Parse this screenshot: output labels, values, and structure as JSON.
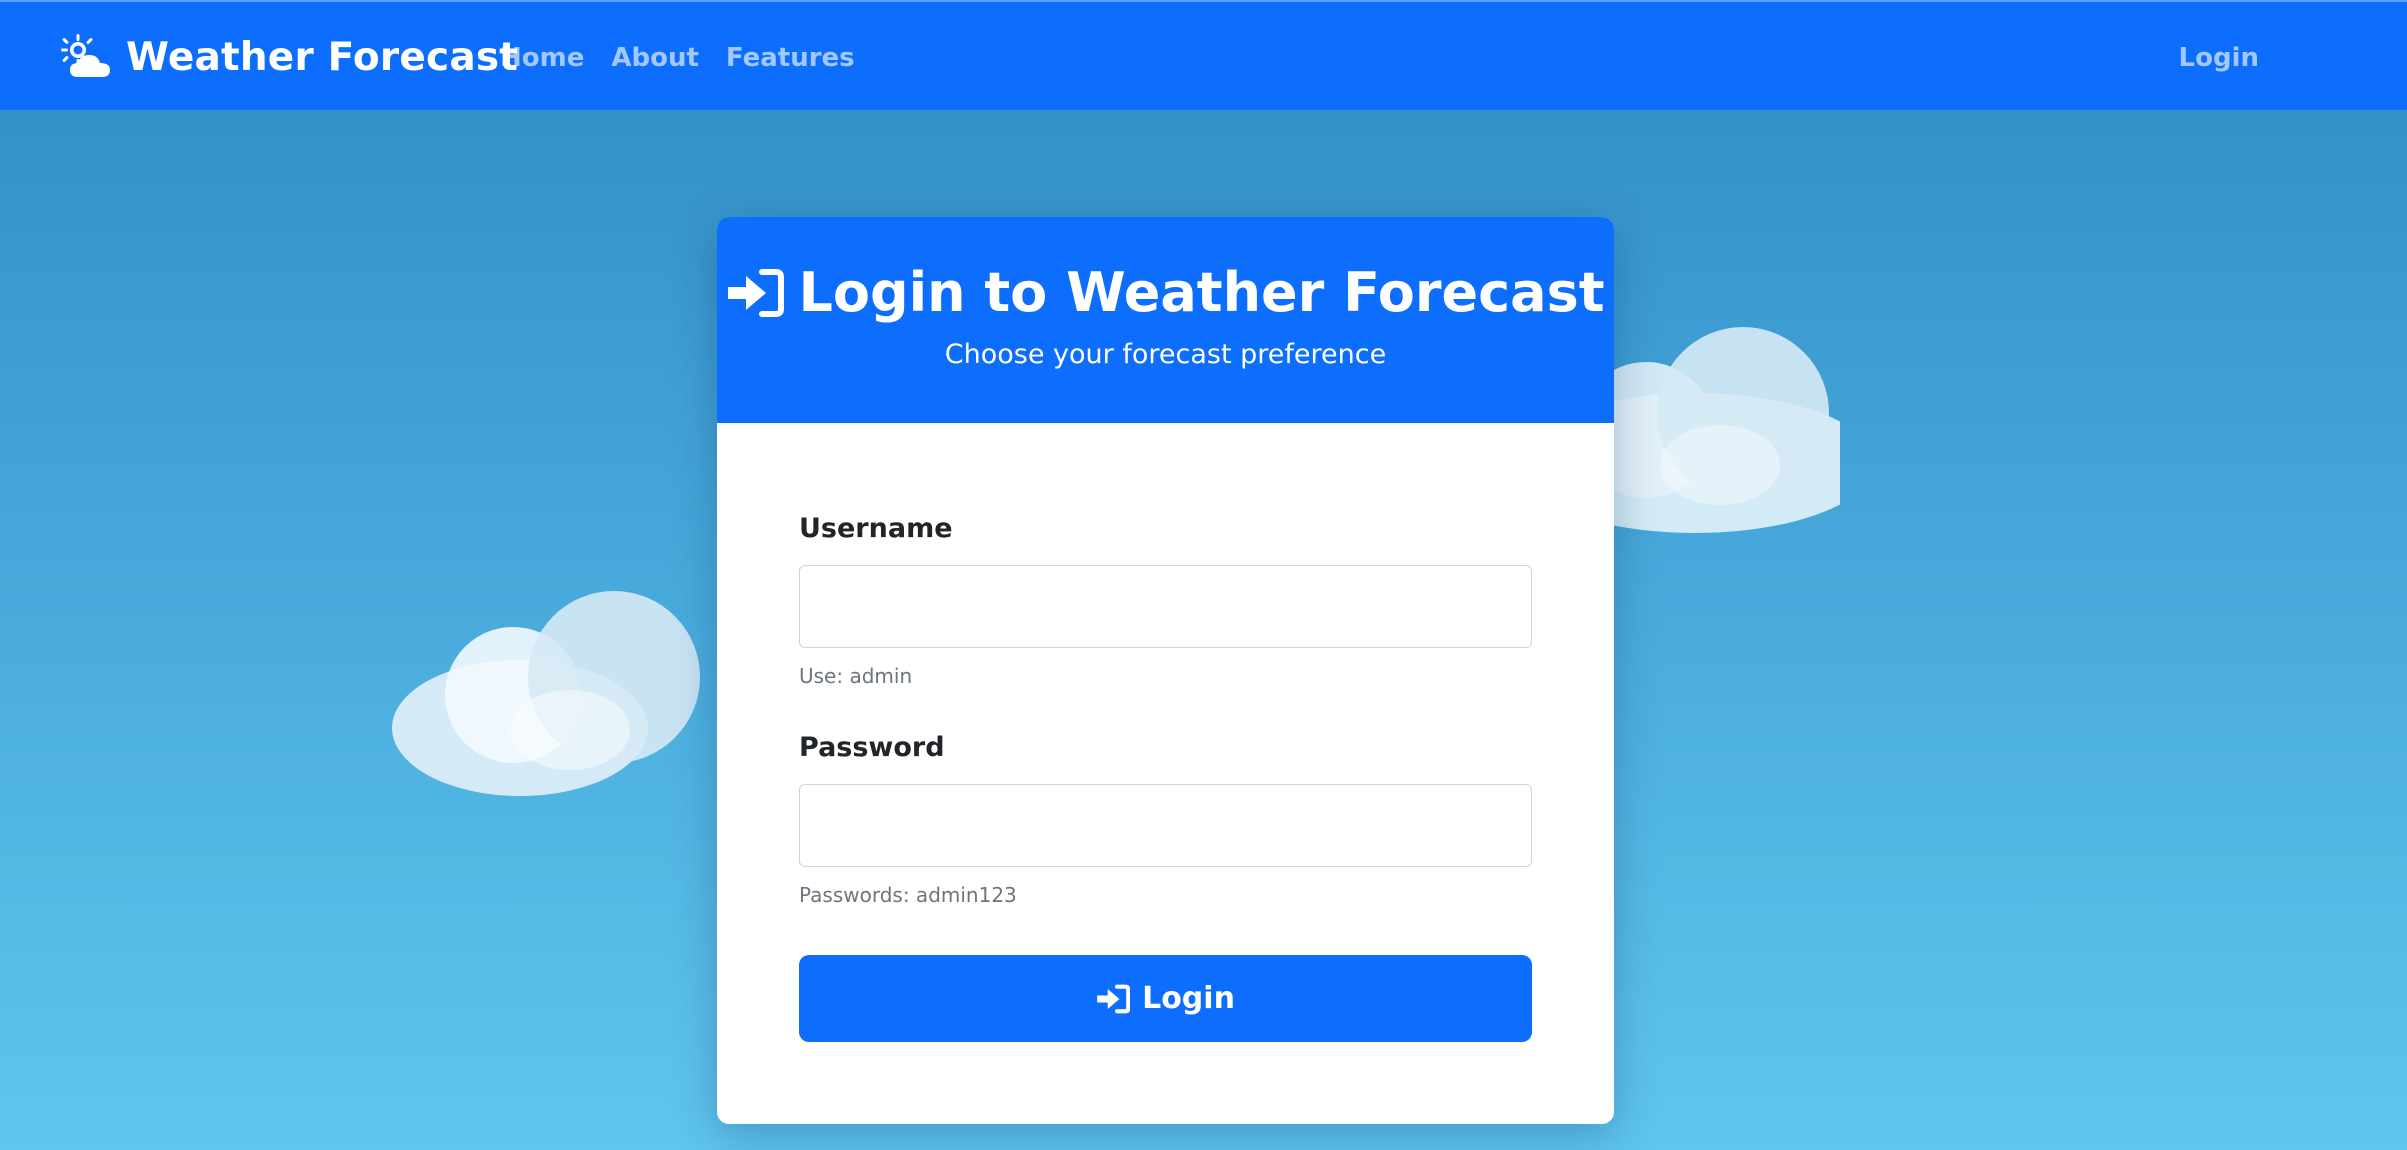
{
  "navbar": {
    "brand_icon": "sun-behind-cloud-icon",
    "brand": "Weather Forecast",
    "links": [
      {
        "label": "Home"
      },
      {
        "label": "About"
      },
      {
        "label": "Features"
      }
    ],
    "login": "Login"
  },
  "card": {
    "title_icon": "sign-in-icon",
    "title": "Login to Weather Forecast",
    "subtitle": "Choose your forecast preference",
    "username": {
      "label": "Username",
      "value": "",
      "hint": "Use: admin"
    },
    "password": {
      "label": "Password",
      "value": "",
      "hint": "Passwords: admin123"
    },
    "submit": {
      "icon": "sign-in-icon",
      "label": "Login"
    }
  },
  "colors": {
    "primary": "#0d6efd",
    "background_top": "#2f8bc4",
    "background_bottom": "#5fc6ee",
    "hint": "#6c757d",
    "label": "#212529"
  }
}
